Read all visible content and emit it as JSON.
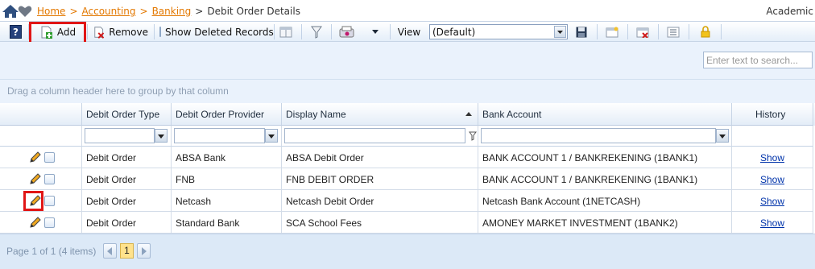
{
  "breadcrumb": {
    "items": [
      "Home",
      "Accounting",
      "Banking"
    ],
    "separator": ">",
    "current": "Debit Order Details"
  },
  "top_right": "Academic",
  "toolbar": {
    "add_label": "Add",
    "remove_label": "Remove",
    "show_deleted_label": "Show Deleted Records",
    "view_label": "View",
    "view_selected": "(Default)"
  },
  "search": {
    "placeholder": "Enter text to search..."
  },
  "group_panel_text": "Drag a column header here to group by that column",
  "grid": {
    "columns": {
      "type": "Debit Order Type",
      "provider": "Debit Order Provider",
      "display": "Display Name",
      "bank": "Bank Account",
      "history": "History"
    },
    "rows": [
      {
        "type": "Debit Order",
        "provider": "ABSA Bank",
        "display": "ABSA Debit Order",
        "bank": "BANK ACCOUNT 1 / BANKREKENING (1BANK1)",
        "history": "Show"
      },
      {
        "type": "Debit Order",
        "provider": "FNB",
        "display": "FNB DEBIT ORDER",
        "bank": "BANK ACCOUNT 1 / BANKREKENING (1BANK1)",
        "history": "Show"
      },
      {
        "type": "Debit Order",
        "provider": "Netcash",
        "display": "Netcash Debit Order",
        "bank": "Netcash Bank Account (1NETCASH)",
        "history": "Show"
      },
      {
        "type": "Debit Order",
        "provider": "Standard Bank",
        "display": "SCA School Fees",
        "bank": "AMONEY MARKET INVESTMENT (1BANK2)",
        "history": "Show"
      }
    ]
  },
  "pager": {
    "info": "Page 1 of 1 (4 items)",
    "current_page": "1"
  },
  "colors": {
    "link_orange": "#e37800",
    "highlight_red": "#e01515",
    "grid_header": "#e3ecf7",
    "pager_current": "#ffe28c"
  }
}
